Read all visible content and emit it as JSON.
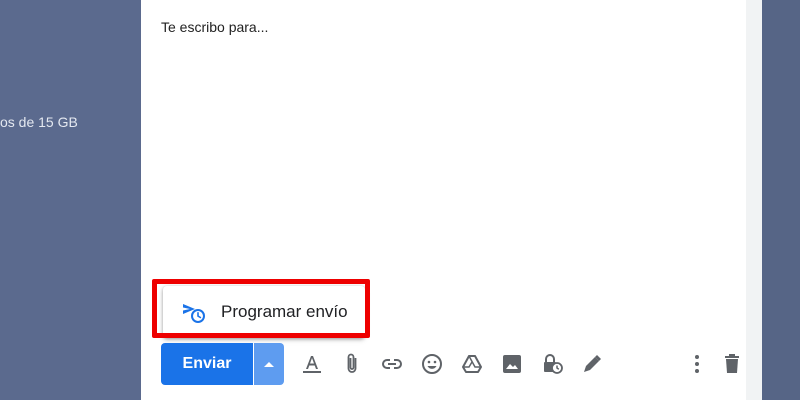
{
  "background": {
    "storage_text": "os de 15 GB"
  },
  "compose": {
    "body_text": "Te escribo para...",
    "schedule_menu": {
      "label": "Programar envío",
      "icon": "schedule-send-icon"
    },
    "send_button": {
      "label": "Enviar"
    },
    "toolbar_icons": [
      "formatting-options-icon",
      "attach-file-icon",
      "insert-link-icon",
      "insert-emoji-icon",
      "google-drive-icon",
      "insert-photo-icon",
      "confidential-mode-icon",
      "signature-icon",
      "more-options-icon",
      "discard-draft-icon"
    ]
  },
  "colors": {
    "primary": "#1a73e8",
    "highlight": "#ee0000",
    "icon": "#5f6368"
  }
}
